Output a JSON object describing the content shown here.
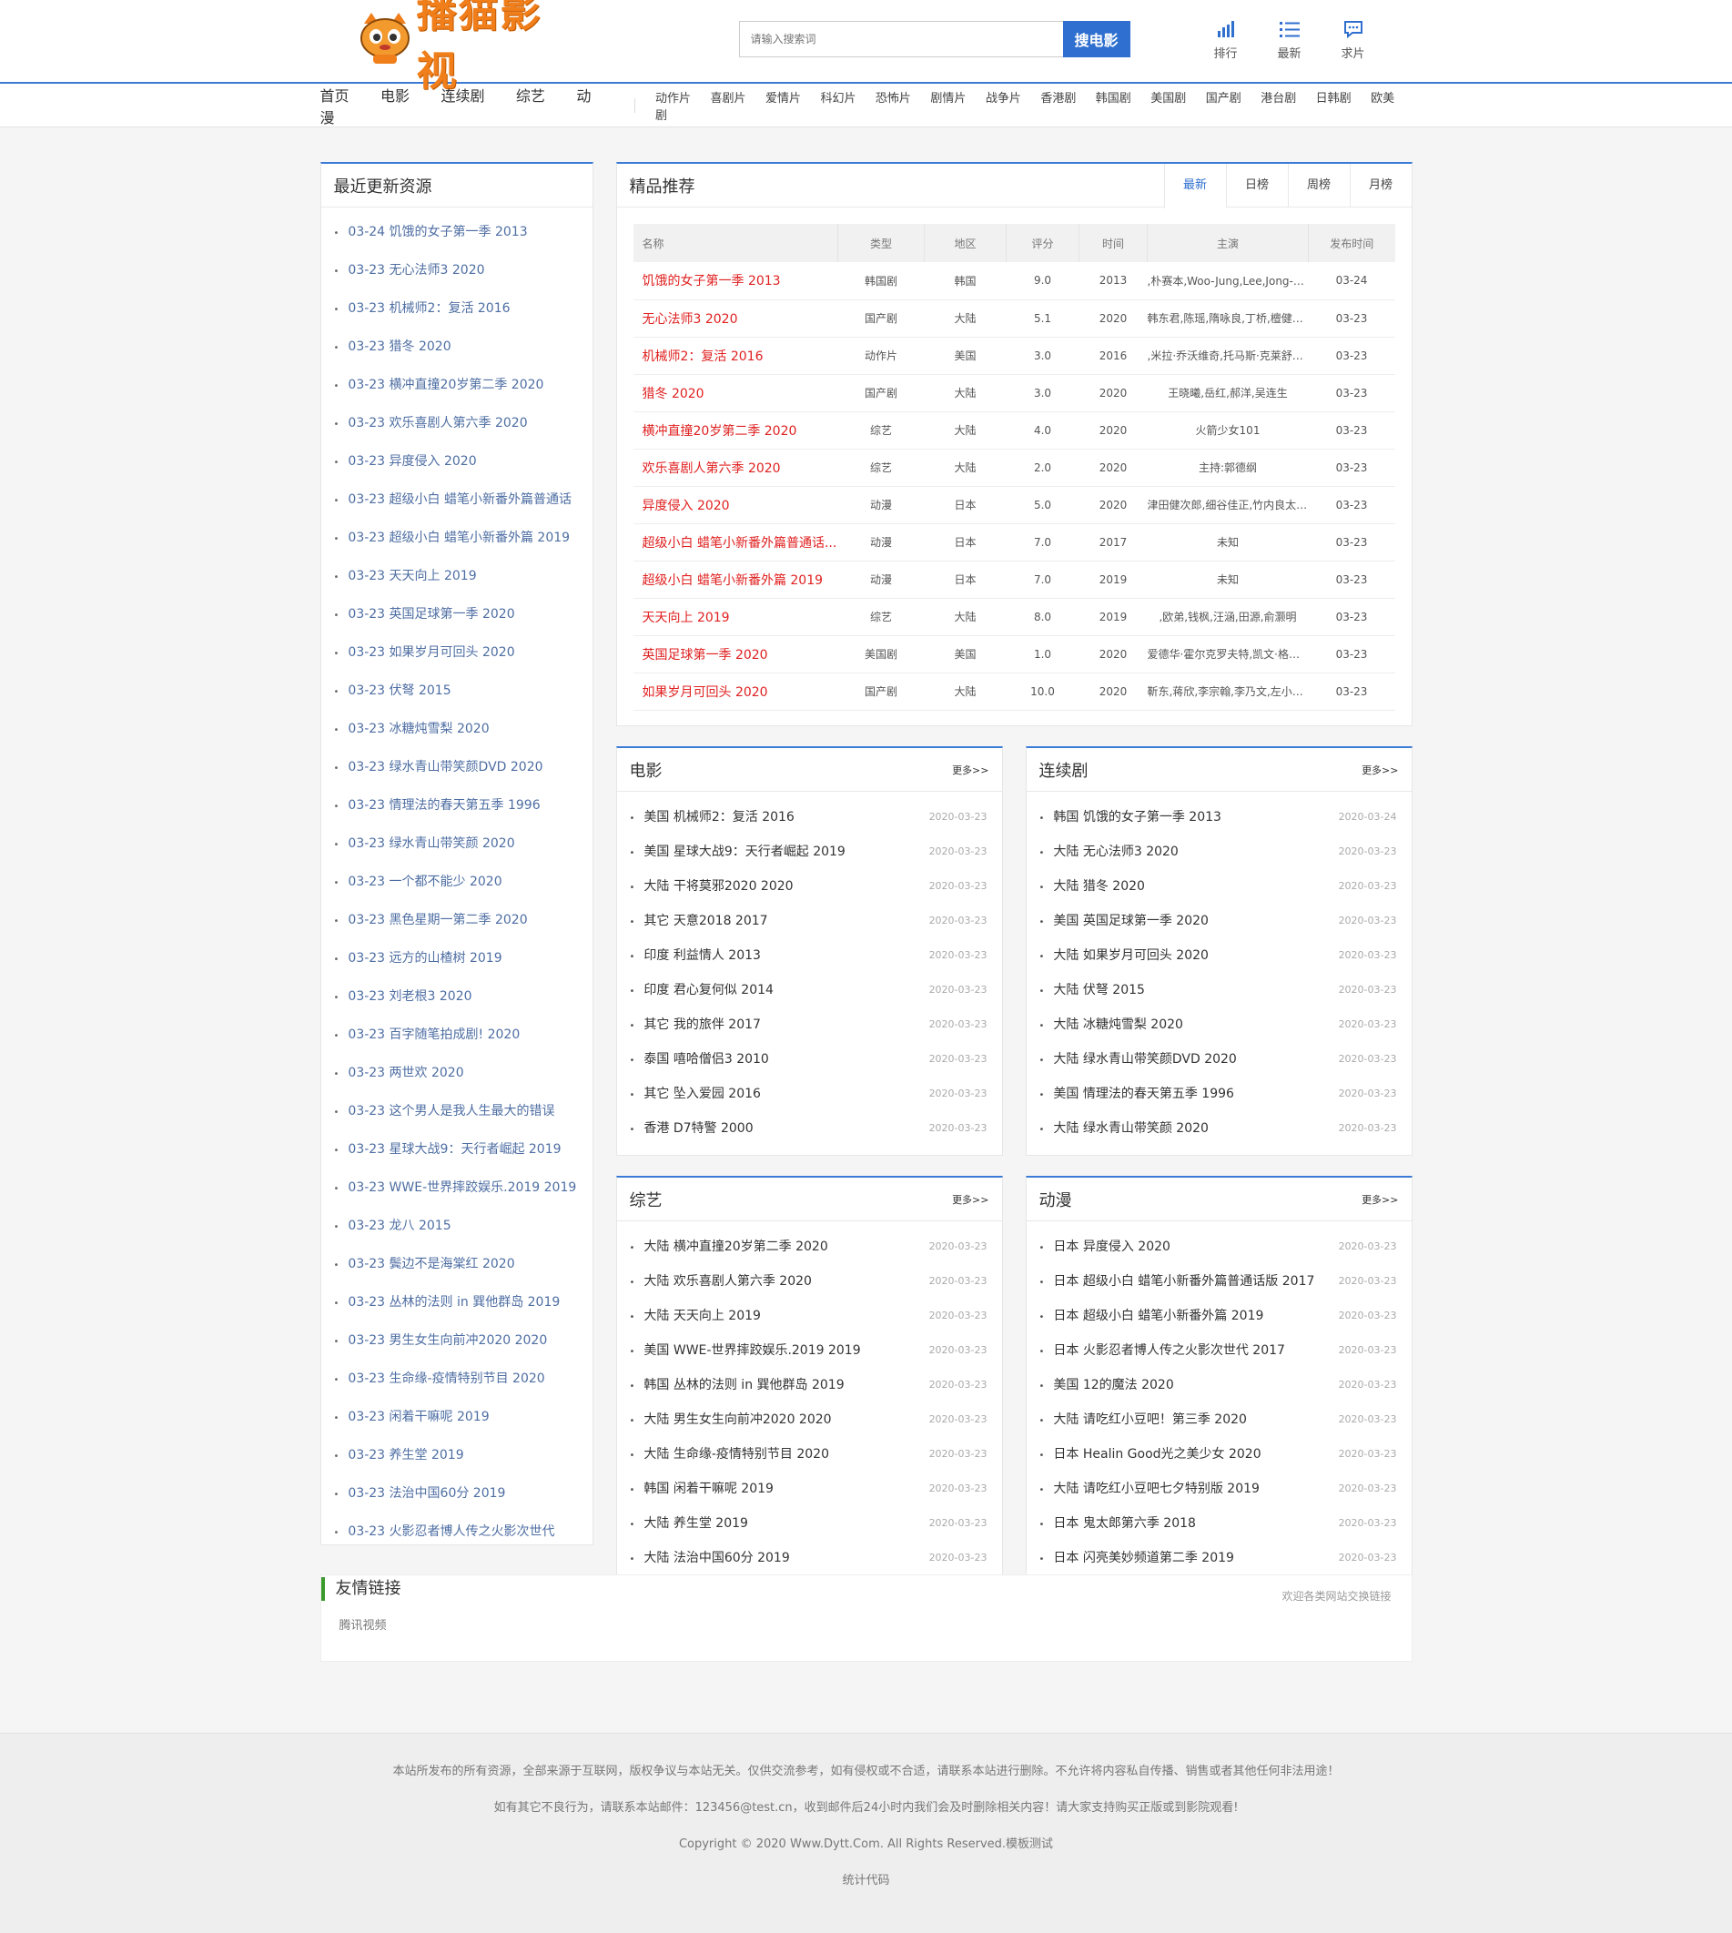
{
  "logo": {
    "text": "播猫影视"
  },
  "search": {
    "placeholder": "请输入搜索词",
    "button": "搜电影"
  },
  "topnav": [
    {
      "label": "排行",
      "icon": "bar-chart-icon"
    },
    {
      "label": "最新",
      "icon": "list-icon"
    },
    {
      "label": "求片",
      "icon": "chat-icon"
    }
  ],
  "nav": {
    "main": [
      "首页",
      "电影",
      "连续剧",
      "综艺",
      "动漫"
    ],
    "cats": [
      "动作片",
      "喜剧片",
      "爱情片",
      "科幻片",
      "恐怖片",
      "剧情片",
      "战争片",
      "香港剧",
      "韩国剧",
      "美国剧",
      "国产剧",
      "港台剧",
      "日韩剧",
      "欧美剧"
    ]
  },
  "recent": {
    "title": "最近更新资源",
    "items": [
      "03-24 饥饿的女子第一季 2013",
      "03-23 无心法师3 2020",
      "03-23 机械师2：复活 2016",
      "03-23 猎冬 2020",
      "03-23 横冲直撞20岁第二季 2020",
      "03-23 欢乐喜剧人第六季 2020",
      "03-23 异度侵入 2020",
      "03-23 超级小白 蜡笔小新番外篇普通话",
      "03-23 超级小白 蜡笔小新番外篇 2019",
      "03-23 天天向上 2019",
      "03-23 英国足球第一季 2020",
      "03-23 如果岁月可回头 2020",
      "03-23 伏弩 2015",
      "03-23 冰糖炖雪梨 2020",
      "03-23 绿水青山带笑颜DVD 2020",
      "03-23 情理法的春天第五季 1996",
      "03-23 绿水青山带笑颜 2020",
      "03-23 一个都不能少 2020",
      "03-23 黑色星期一第二季 2020",
      "03-23 远方的山楂树 2019",
      "03-23 刘老根3 2020",
      "03-23 百字随笔拍成剧! 2020",
      "03-23 两世欢 2020",
      "03-23 这个男人是我人生最大的错误",
      "03-23 星球大战9：天行者崛起 2019",
      "03-23 WWE-世界摔跤娱乐.2019 2019",
      "03-23 龙八 2015",
      "03-23 鬓边不是海棠红 2020",
      "03-23 丛林的法则 in 巽他群岛 2019",
      "03-23 男生女生向前冲2020 2020",
      "03-23 生命缘-疫情特别节目 2020",
      "03-23 闲着干嘛呢 2019",
      "03-23 养生堂 2019",
      "03-23 法治中国60分 2019",
      "03-23 火影忍者博人传之火影次世代"
    ]
  },
  "rec": {
    "title": "精品推荐",
    "tabs": [
      "最新",
      "日榜",
      "周榜",
      "月榜"
    ],
    "headers": [
      "名称",
      "类型",
      "地区",
      "评分",
      "时间",
      "主演",
      "发布时间"
    ],
    "rows": [
      [
        "饥饿的女子第一季 2013",
        "韩国剧",
        "韩国",
        "9.0",
        "2013",
        ",朴赛本,Woo-Jung,Lee,Jong-h...",
        "03-24"
      ],
      [
        "无心法师3 2020",
        "国产剧",
        "大陆",
        "5.1",
        "2020",
        "韩东君,陈瑶,隋咏良,丁桥,檀健次...",
        "03-23"
      ],
      [
        "机械师2：复活 2016",
        "动作片",
        "美国",
        "3.0",
        "2016",
        ",米拉·乔沃维奇,托马斯·克莱舒曼...",
        "03-23"
      ],
      [
        "猎冬 2020",
        "国产剧",
        "大陆",
        "3.0",
        "2020",
        "王晓曦,岳红,郝洋,吴连生",
        "03-23"
      ],
      [
        "横冲直撞20岁第二季 2020",
        "综艺",
        "大陆",
        "4.0",
        "2020",
        "火箭少女101",
        "03-23"
      ],
      [
        "欢乐喜剧人第六季 2020",
        "综艺",
        "大陆",
        "2.0",
        "2020",
        "主持:郭德纲",
        "03-23"
      ],
      [
        "异度侵入 2020",
        "动漫",
        "日本",
        "5.0",
        "2020",
        "津田健次郎,细谷佳正,竹内良太,...",
        "03-23"
      ],
      [
        "超级小白 蜡笔小新番外篇普通话...",
        "动漫",
        "日本",
        "7.0",
        "2017",
        "未知",
        "03-23"
      ],
      [
        "超级小白 蜡笔小新番外篇 2019",
        "动漫",
        "日本",
        "7.0",
        "2019",
        "未知",
        "03-23"
      ],
      [
        "天天向上 2019",
        "综艺",
        "大陆",
        "8.0",
        "2019",
        ",欧弟,钱枫,汪涵,田源,俞灏明",
        "03-23"
      ],
      [
        "英国足球第一季 2020",
        "美国剧",
        "美国",
        "1.0",
        "2020",
        "爱德华·霍尔克罗夫特,凯文·格思...",
        "03-23"
      ],
      [
        "如果岁月可回头 2020",
        "国产剧",
        "大陆",
        "10.0",
        "2020",
        "靳东,蒋欣,李宗翰,李乃文,左小青...",
        "03-23"
      ]
    ]
  },
  "sections": [
    {
      "title": "电影",
      "more": "更多>>",
      "items": [
        [
          "美国 机械师2：复活 2016",
          "2020-03-23"
        ],
        [
          "美国 星球大战9：天行者崛起 2019",
          "2020-03-23"
        ],
        [
          "大陆 干将莫邪2020 2020",
          "2020-03-23"
        ],
        [
          "其它 天意2018 2017",
          "2020-03-23"
        ],
        [
          "印度 利益情人 2013",
          "2020-03-23"
        ],
        [
          "印度 君心复何似 2014",
          "2020-03-23"
        ],
        [
          "其它 我的旅伴 2017",
          "2020-03-23"
        ],
        [
          "泰国 嘻哈僧侣3 2010",
          "2020-03-23"
        ],
        [
          "其它 坠入爱园 2016",
          "2020-03-23"
        ],
        [
          "香港 D7特警 2000",
          "2020-03-23"
        ]
      ]
    },
    {
      "title": "连续剧",
      "more": "更多>>",
      "items": [
        [
          "韩国 饥饿的女子第一季 2013",
          "2020-03-24"
        ],
        [
          "大陆 无心法师3 2020",
          "2020-03-23"
        ],
        [
          "大陆 猎冬 2020",
          "2020-03-23"
        ],
        [
          "美国 英国足球第一季 2020",
          "2020-03-23"
        ],
        [
          "大陆 如果岁月可回头 2020",
          "2020-03-23"
        ],
        [
          "大陆 伏弩 2015",
          "2020-03-23"
        ],
        [
          "大陆 冰糖炖雪梨 2020",
          "2020-03-23"
        ],
        [
          "大陆 绿水青山带笑颜DVD 2020",
          "2020-03-23"
        ],
        [
          "美国 情理法的春天第五季 1996",
          "2020-03-23"
        ],
        [
          "大陆 绿水青山带笑颜 2020",
          "2020-03-23"
        ]
      ]
    },
    {
      "title": "综艺",
      "more": "更多>>",
      "items": [
        [
          "大陆 横冲直撞20岁第二季 2020",
          "2020-03-23"
        ],
        [
          "大陆 欢乐喜剧人第六季 2020",
          "2020-03-23"
        ],
        [
          "大陆 天天向上 2019",
          "2020-03-23"
        ],
        [
          "美国 WWE-世界摔跤娱乐.2019 2019",
          "2020-03-23"
        ],
        [
          "韩国 丛林的法则 in 巽他群岛 2019",
          "2020-03-23"
        ],
        [
          "大陆 男生女生向前冲2020 2020",
          "2020-03-23"
        ],
        [
          "大陆 生命缘-疫情特别节目 2020",
          "2020-03-23"
        ],
        [
          "韩国 闲着干嘛呢 2019",
          "2020-03-23"
        ],
        [
          "大陆 养生堂 2019",
          "2020-03-23"
        ],
        [
          "大陆 法治中国60分 2019",
          "2020-03-23"
        ]
      ]
    },
    {
      "title": "动漫",
      "more": "更多>>",
      "items": [
        [
          "日本 异度侵入 2020",
          "2020-03-23"
        ],
        [
          "日本 超级小白 蜡笔小新番外篇普通话版 2017",
          "2020-03-23"
        ],
        [
          "日本 超级小白 蜡笔小新番外篇 2019",
          "2020-03-23"
        ],
        [
          "日本 火影忍者博人传之火影次世代 2017",
          "2020-03-23"
        ],
        [
          "美国 12的魔法 2020",
          "2020-03-23"
        ],
        [
          "大陆 请吃红小豆吧！第三季 2020",
          "2020-03-23"
        ],
        [
          "日本 Healin Good光之美少女 2020",
          "2020-03-23"
        ],
        [
          "大陆 请吃红小豆吧七夕特别版 2019",
          "2020-03-23"
        ],
        [
          "日本 鬼太郎第六季 2018",
          "2020-03-23"
        ],
        [
          "日本 闪亮美妙频道第二季 2019",
          "2020-03-23"
        ]
      ]
    }
  ],
  "friend": {
    "title": "友情链接",
    "note": "欢迎各类网站交换链接",
    "links": [
      "腾讯视频"
    ]
  },
  "footer": {
    "lines": [
      "本站所发布的所有资源，全部来源于互联网，版权争议与本站无关。仅供交流参考，如有侵权或不合适，请联系本站进行删除。不允许将内容私自传播、销售或者其他任何非法用途！",
      "如有其它不良行为，请联系本站邮件：123456@test.cn，收到邮件后24小时内我们会及时删除相关内容！请大家支持购买正版或到影院观看!",
      "Copyright © 2020 Www.Dytt.Com. All Rights Reserved.模板测试",
      "统计代码"
    ]
  },
  "colors": {
    "accent": "#3a7bd5",
    "logo": "#f07e1a",
    "hot": "#e02020",
    "link": "#4e6ea3"
  }
}
